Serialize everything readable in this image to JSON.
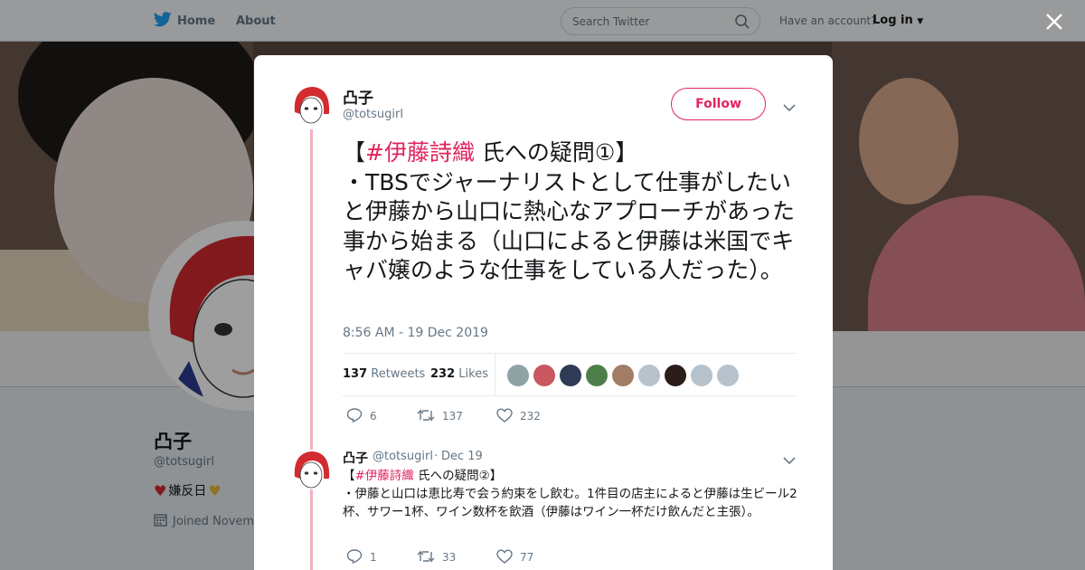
{
  "topbar": {
    "home_label": "Home",
    "about_label": "About",
    "search_placeholder": "Search Twitter",
    "have_account": "Have an account?",
    "login_label": "Log in"
  },
  "profile": {
    "name": "凸子",
    "handle": "@totsugirl",
    "bio": "嫌反日",
    "joined": "Joined Novem"
  },
  "tweet": {
    "author_name": "凸子",
    "author_handle": "@totsugirl",
    "follow_label": "Follow",
    "bracket_open": "【",
    "hashtag": "#伊藤詩織",
    "text_after_hashtag": " 氏への疑問①】",
    "body": "・TBSでジャーナリストとして仕事がしたいと伊藤から山口に熱心なアプローチがあった事から始まる（山口によると伊藤は米国でキャバ嬢のような仕事をしている人だった）。",
    "timestamp": "8:56 AM - 19 Dec 2019",
    "retweets_count": "137",
    "retweets_label": "Retweets",
    "likes_count": "232",
    "likes_label": "Likes",
    "reply_count": "6",
    "retweet_action_count": "137",
    "like_action_count": "232"
  },
  "reply": {
    "author_name": "凸子",
    "author_handle": "@totsugirl",
    "dot": "·",
    "date": "Dec 19",
    "bracket_open": "【",
    "hashtag": "#伊藤詩織",
    "text_after_hashtag": " 氏への疑問②】",
    "body": "・伊藤と山口は恵比寿で会う約束をし飲む。1件目の店主によると伊藤は生ビール2杯、サワー1杯、ワイン数杯を飲酒（伊藤はワイン一杯だけ飲んだと主張）。",
    "reply_count": "1",
    "retweet_count": "33",
    "like_count": "77"
  },
  "liker_colors": [
    "#8fa3a7",
    "#c9585f",
    "#2f3a55",
    "#4e7f4a",
    "#a07d64",
    "#b6c2cc",
    "#2a1d1a",
    "#b6c2cc",
    "#b6c2cc"
  ],
  "colors": {
    "accent": "#e0245e",
    "twitter_blue": "#1da1f2",
    "muted": "#657786",
    "thread_line": "#f1b1bd"
  }
}
